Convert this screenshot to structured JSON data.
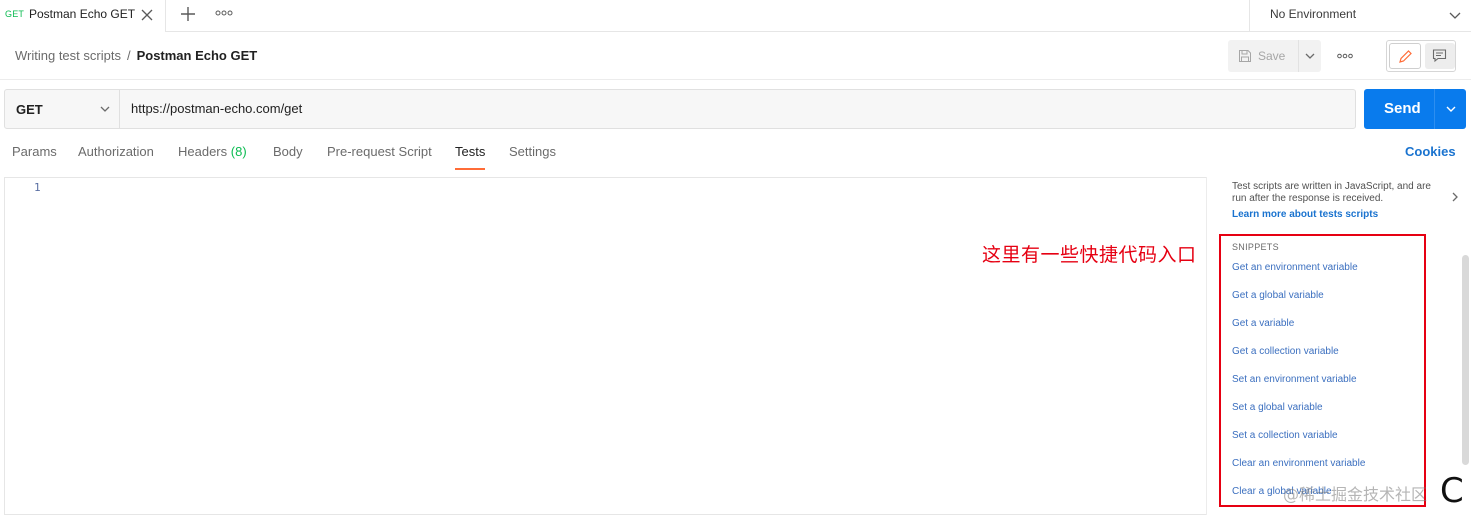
{
  "tab": {
    "method": "GET",
    "title": "Postman Echo GET"
  },
  "environment": {
    "label": "No Environment"
  },
  "breadcrumb": {
    "parent": "Writing test scripts",
    "separator": "/",
    "current": "Postman Echo GET"
  },
  "toolbar": {
    "save_label": "Save"
  },
  "request": {
    "method": "GET",
    "url": "https://postman-echo.com/get",
    "send_label": "Send"
  },
  "request_tabs": {
    "params": "Params",
    "authorization": "Authorization",
    "headers": "Headers",
    "headers_count": "(8)",
    "body": "Body",
    "prerequest": "Pre-request Script",
    "tests": "Tests",
    "settings": "Settings",
    "cookies": "Cookies"
  },
  "editor": {
    "line_number": "1"
  },
  "side_panel": {
    "description": "Test scripts are written in JavaScript, and are run after the response is received.",
    "learn_more": "Learn more about tests scripts",
    "snippets_heading": "SNIPPETS",
    "snippets": [
      "Get an environment variable",
      "Get a global variable",
      "Get a variable",
      "Get a collection variable",
      "Set an environment variable",
      "Set a global variable",
      "Set a collection variable",
      "Clear an environment variable",
      "Clear a global variable"
    ]
  },
  "annotation": {
    "text": "这里有一些快捷代码入口"
  },
  "watermark": {
    "text": "@稀土掘金技术社区"
  },
  "corner_glyph": "C",
  "colors": {
    "accent_orange": "#ff6c37",
    "send_blue": "#097bed",
    "link_blue": "#1a73cf",
    "get_green": "#0cbb52",
    "annotation_red": "#e60012"
  }
}
